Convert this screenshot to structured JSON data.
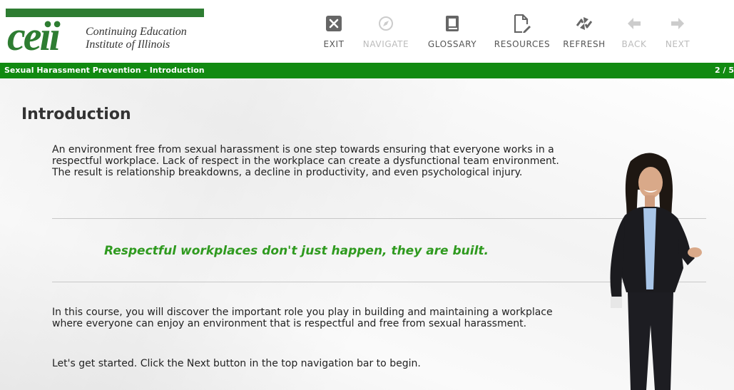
{
  "header": {
    "logo": {
      "mark_text": "ceii",
      "line1": "Continuing Education",
      "line2": "Institute of Illinois"
    },
    "nav": [
      {
        "label": "EXIT",
        "icon": "close-icon",
        "enabled": true
      },
      {
        "label": "NAVIGATE",
        "icon": "compass-icon",
        "enabled": false
      },
      {
        "label": "GLOSSARY",
        "icon": "book-icon",
        "enabled": true
      },
      {
        "label": "RESOURCES",
        "icon": "document-edit-icon",
        "enabled": true
      },
      {
        "label": "REFRESH",
        "icon": "refresh-icon",
        "enabled": true
      },
      {
        "label": "BACK",
        "icon": "arrow-left-icon",
        "enabled": false
      },
      {
        "label": "NEXT",
        "icon": "arrow-right-icon",
        "enabled": false
      }
    ]
  },
  "titlebar": {
    "course_title": "Sexual Harassment Prevention - Introduction",
    "page_indicator": "2 / 5"
  },
  "content": {
    "heading": "Introduction",
    "paragraph1": "An environment free from sexual harassment is one step towards ensuring that everyone works in a respectful workplace. Lack of respect in the workplace can create a dysfunctional team environment. The result is relationship breakdowns, a decline in productivity, and even psychological injury.",
    "quote": "Respectful workplaces don't just happen, they are built.",
    "paragraph2": "In this course, you will discover the important role you play in building and maintaining a workplace where everyone can enjoy an environment that is respectful and free from sexual harassment.",
    "paragraph3": "Let's get started. Click the Next button in the top navigation bar to begin."
  },
  "colors": {
    "brand_green": "#2e7d32",
    "titlebar_green": "#118a11",
    "quote_green": "#2f9a1f"
  }
}
